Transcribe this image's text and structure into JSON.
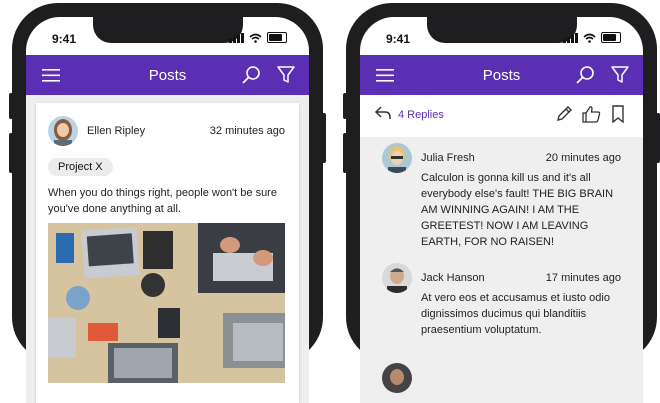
{
  "left_phone": {
    "status_time": "9:41",
    "appbar_title": "Posts",
    "post": {
      "author": "Ellen Ripley",
      "time": "32 minutes ago",
      "tag": "Project X",
      "text": "When you do things right, people won't be sure you've done anything at all."
    }
  },
  "right_phone": {
    "status_time": "9:41",
    "appbar_title": "Posts",
    "replies_label": "4 Replies",
    "comments": [
      {
        "author": "Julia Fresh",
        "time": "20 minutes ago",
        "text": "Calculon is gonna kill us and it's all everybody else's fault! THE BIG BRAIN AM WINNING AGAIN! I AM THE GREETEST! NOW I AM LEAVING EARTH, FOR NO RAISEN!"
      },
      {
        "author": "Jack Hanson",
        "time": "17 minutes ago",
        "text": "At vero eos et accusamus et iusto odio dignissimos ducimus qui blanditiis praesentium voluptatum."
      }
    ]
  },
  "colors": {
    "accent": "#5b2fb4",
    "phone_frame": "#1e1e20",
    "background": "#eeeeee"
  },
  "icons": [
    "menu-icon",
    "search-icon",
    "filter-icon",
    "reply-icon",
    "edit-icon",
    "like-icon",
    "bookmark-icon"
  ]
}
